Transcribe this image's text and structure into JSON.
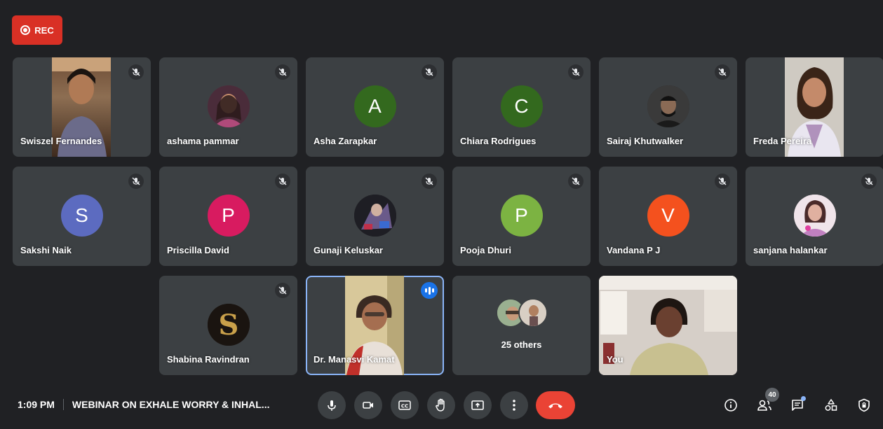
{
  "recording": {
    "label": "REC",
    "color": "#d93025"
  },
  "meeting": {
    "time": "1:09 PM",
    "title": "WEBINAR ON EXHALE WORRY & INHAL..."
  },
  "participants": {
    "swiszel": {
      "name": "Swiszel Fernandes",
      "muted": true,
      "type": "video"
    },
    "ashama": {
      "name": "ashama pammar",
      "muted": true,
      "type": "photo"
    },
    "asha": {
      "name": "Asha Zarapkar",
      "muted": true,
      "type": "initial",
      "initial": "A",
      "color": "#33691e"
    },
    "chiara": {
      "name": "Chiara Rodrigues",
      "muted": true,
      "type": "initial",
      "initial": "C",
      "color": "#33691e"
    },
    "sairaj": {
      "name": "Sairaj Khutwalker",
      "muted": true,
      "type": "photo"
    },
    "freda": {
      "name": "Freda Pereira",
      "muted": false,
      "type": "video"
    },
    "sakshi": {
      "name": "Sakshi Naik",
      "muted": true,
      "type": "initial",
      "initial": "S",
      "color": "#5c6bc0"
    },
    "priscilla": {
      "name": "Priscilla David",
      "muted": true,
      "type": "initial",
      "initial": "P",
      "color": "#d81b60"
    },
    "gunaji": {
      "name": "Gunaji Keluskar",
      "muted": true,
      "type": "photo"
    },
    "pooja": {
      "name": "Pooja Dhuri",
      "muted": true,
      "type": "initial",
      "initial": "P",
      "color": "#7cb342"
    },
    "vandana": {
      "name": "Vandana P J",
      "muted": true,
      "type": "initial",
      "initial": "V",
      "color": "#f4511e"
    },
    "sanjana": {
      "name": "sanjana halankar",
      "muted": true,
      "type": "photo"
    },
    "shabina": {
      "name": "Shabina Ravindran",
      "muted": true,
      "type": "photo"
    },
    "manasvi": {
      "name": "Dr. Manasvi Kamat",
      "muted": false,
      "speaking": true,
      "type": "video"
    },
    "others": {
      "label": "25 others"
    },
    "you": {
      "name": "You",
      "type": "video"
    }
  },
  "toolbar": {
    "icons": [
      "mic-icon",
      "camera-icon",
      "captions-icon",
      "raise-hand-icon",
      "present-icon",
      "more-options-icon",
      "end-call-icon"
    ],
    "end_call_color": "#ea4335"
  },
  "side_toolbar": {
    "icons": [
      "info-icon",
      "people-icon",
      "chat-icon",
      "activities-icon",
      "host-controls-icon"
    ],
    "people_count": "40"
  }
}
